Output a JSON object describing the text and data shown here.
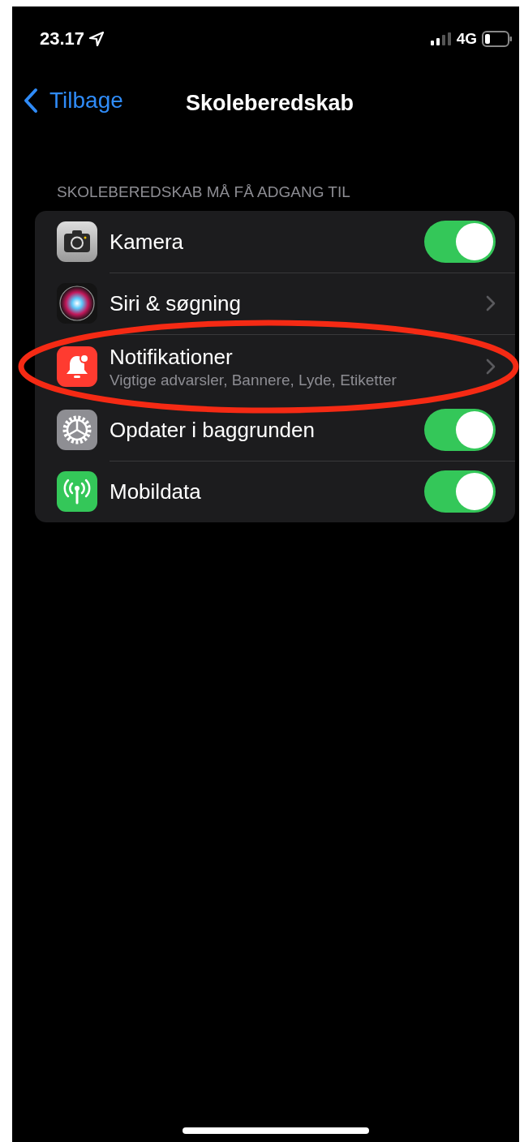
{
  "status_bar": {
    "time": "23.17",
    "network": "4G"
  },
  "nav": {
    "back": "Tilbage",
    "title": "Skoleberedskab"
  },
  "section": {
    "header": "SKOLEBEREDSKAB MÅ FÅ ADGANG TIL",
    "rows": [
      {
        "kind": "toggle",
        "label": "Kamera",
        "on": true,
        "highlighted": false
      },
      {
        "kind": "link",
        "label": "Siri & søgning",
        "highlighted": false
      },
      {
        "kind": "link",
        "label": "Notifikationer",
        "subtitle": "Vigtige advarsler, Bannere, Lyde, Etiketter",
        "highlighted": true
      },
      {
        "kind": "toggle",
        "label": "Opdater i baggrunden",
        "on": true,
        "highlighted": false
      },
      {
        "kind": "toggle",
        "label": "Mobildata",
        "on": true,
        "highlighted": false
      }
    ]
  }
}
